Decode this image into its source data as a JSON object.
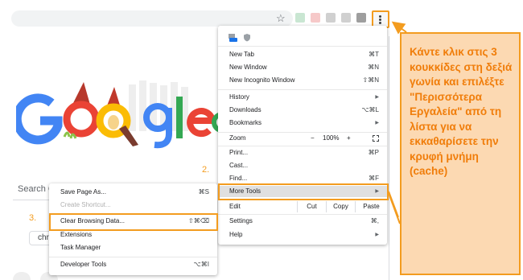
{
  "browser": {
    "star_icon": "star-icon",
    "menu_icon": "three-dots-vertical-icon",
    "extension_colors": [
      "#c9e6d2",
      "#f6c9c9",
      "#d0d0d0",
      "#d0d0d0",
      "#9e9e9e"
    ]
  },
  "page": {
    "search_fragment": "Search G",
    "chip_text": "chr"
  },
  "doodle": {
    "letters": [
      "G",
      "o",
      "o",
      "g",
      "l",
      "e"
    ],
    "colors": [
      "#4285f4",
      "#ea4335",
      "#fbbc05",
      "#4285f4",
      "#34a853",
      "#ea4335"
    ]
  },
  "menu": {
    "items": [
      {
        "label": "New Tab",
        "shortcut": "⌘T"
      },
      {
        "label": "New Window",
        "shortcut": "⌘N"
      },
      {
        "label": "New Incognito Window",
        "shortcut": "⇧⌘N"
      },
      {
        "label": "History",
        "arrow": "▶"
      },
      {
        "label": "Downloads",
        "shortcut": "⌥⌘L"
      },
      {
        "label": "Bookmarks",
        "arrow": "▶"
      },
      {
        "label": "Zoom"
      },
      {
        "label": "Print...",
        "shortcut": "⌘P"
      },
      {
        "label": "Cast..."
      },
      {
        "label": "Find...",
        "shortcut": "⌘F"
      },
      {
        "label": "More Tools",
        "arrow": "▶"
      },
      {
        "label": "Edit"
      },
      {
        "label": "Settings",
        "shortcut": "⌘,"
      },
      {
        "label": "Help",
        "arrow": "▶"
      }
    ],
    "zoom": {
      "minus": "−",
      "value": "100%",
      "plus": "+"
    },
    "edit": {
      "cut": "Cut",
      "copy": "Copy",
      "paste": "Paste"
    },
    "header_icons": [
      "new-badge-icon",
      "shield-icon"
    ]
  },
  "submenu": {
    "items": [
      {
        "label": "Save Page As...",
        "shortcut": "⌘S"
      },
      {
        "label": "Create Shortcut..."
      },
      {
        "label": "Clear Browsing Data...",
        "shortcut": "⇧⌘⌫"
      },
      {
        "label": "Extensions"
      },
      {
        "label": "Task Manager"
      },
      {
        "label": "Developer Tools",
        "shortcut": "⌥⌘I"
      }
    ]
  },
  "annotations": {
    "step2": "2.",
    "step3": "3.",
    "callout_text": "Κάντε κλικ στις 3 κουκκίδες στη δεξιά γωνία και επιλέξτε \"Περισσότερα Εργαλεία\" από τη λίστα για να εκκαθαρίσετε την κρυφή μνήμη (cache)",
    "accent_color": "#f39c1f"
  }
}
